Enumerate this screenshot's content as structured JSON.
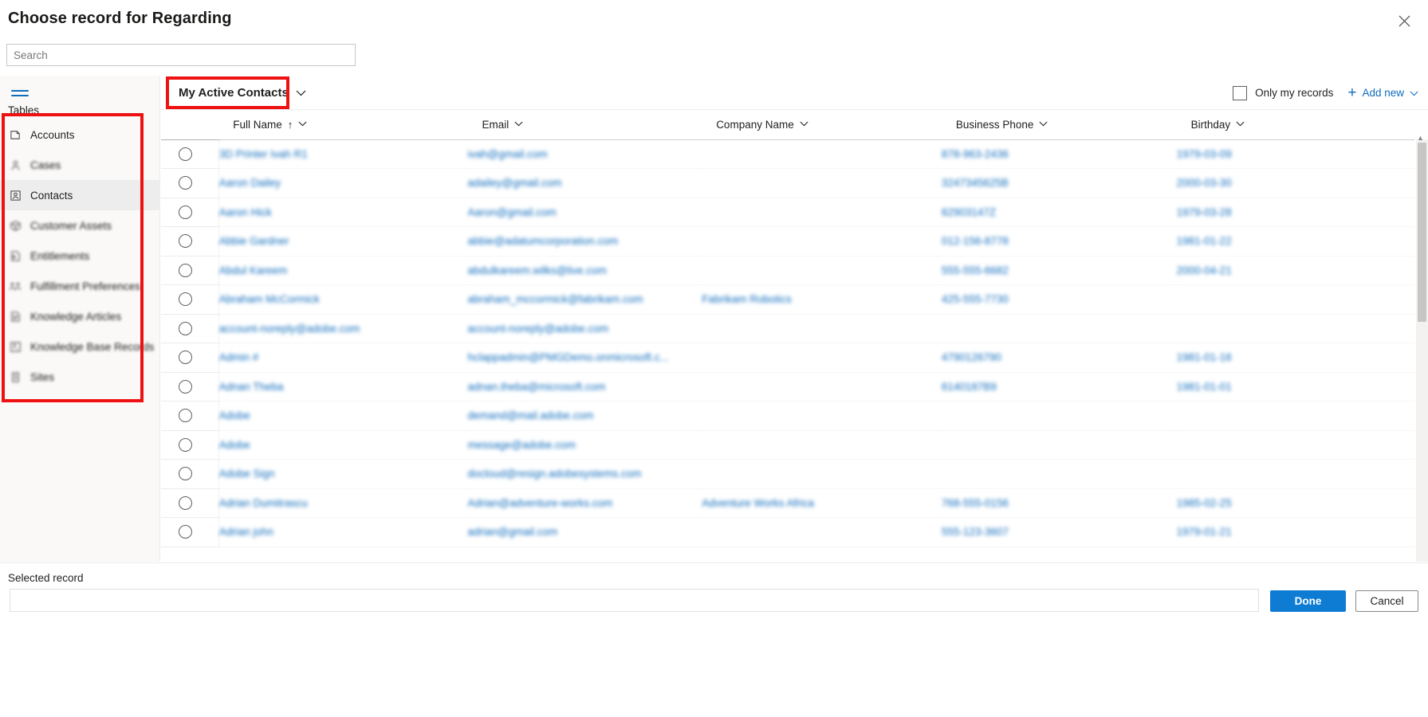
{
  "dialog": {
    "title": "Choose record for Regarding",
    "close_icon": "close-icon"
  },
  "search": {
    "placeholder": "Search",
    "value": ""
  },
  "sidebar": {
    "menu_icon": "hamburger-menu-icon",
    "heading": "Tables",
    "items": [
      {
        "label": "Accounts",
        "icon": "account-icon",
        "selected": false,
        "blurred": false
      },
      {
        "label": "Cases",
        "icon": "case-icon",
        "selected": false,
        "blurred": true
      },
      {
        "label": "Contacts",
        "icon": "contact-icon",
        "selected": true,
        "blurred": false
      },
      {
        "label": "Customer Assets",
        "icon": "box-icon",
        "selected": false,
        "blurred": true
      },
      {
        "label": "Entitlements",
        "icon": "entitlement-icon",
        "selected": false,
        "blurred": true
      },
      {
        "label": "Fulfillment Preferences",
        "icon": "people-icon",
        "selected": false,
        "blurred": true
      },
      {
        "label": "Knowledge Articles",
        "icon": "article-icon",
        "selected": false,
        "blurred": true
      },
      {
        "label": "Knowledge Base Records",
        "icon": "knowledge-base-icon",
        "selected": false,
        "blurred": true
      },
      {
        "label": "Sites",
        "icon": "site-icon",
        "selected": false,
        "blurred": true
      }
    ]
  },
  "commandbar": {
    "view_selector": "My Active Contacts",
    "view_chevron": "chevron-down-icon",
    "only_my_records": "Only my records",
    "only_my_records_checked": false,
    "add_new": "Add new",
    "add_new_chevron": "chevron-down-icon",
    "plus_icon": "plus-icon"
  },
  "grid": {
    "columns": [
      {
        "label": "Full Name",
        "sorted": true,
        "sort_direction": "asc"
      },
      {
        "label": "Email",
        "sorted": false
      },
      {
        "label": "Company Name",
        "sorted": false
      },
      {
        "label": "Business Phone",
        "sorted": false
      },
      {
        "label": "Birthday",
        "sorted": false
      }
    ],
    "sort_arrow": "↑",
    "rows": [
      {
        "full_name": "3D Printer Ivah R1",
        "email": "ivah@gmail.com",
        "company": "",
        "phone": "878-963-2436",
        "birthday": "1979-03-09"
      },
      {
        "full_name": "Aaron Dailey",
        "email": "adailey@gmail.com",
        "company": "",
        "phone": "3247345625B",
        "birthday": "2000-03-30"
      },
      {
        "full_name": "Aaron Hick",
        "email": "Aaron@gmail.com",
        "company": "",
        "phone": "62903147Z",
        "birthday": "1979-03-28"
      },
      {
        "full_name": "Abbie Gardner",
        "email": "abbie@adatumcorporation.com",
        "company": "",
        "phone": "012-156-8778",
        "birthday": "1981-01-22"
      },
      {
        "full_name": "Abdul Kareem",
        "email": "abdulkareem.wilks@live.com",
        "company": "",
        "phone": "555-555-6682",
        "birthday": "2000-04-21"
      },
      {
        "full_name": "Abraham McCormick",
        "email": "abraham_mccormick@fabrikam.com",
        "company": "Fabrikam Robotics",
        "phone": "425-555-7730",
        "birthday": ""
      },
      {
        "full_name": "account-noreply@adobe.com",
        "email": "account-noreply@adobe.com",
        "company": "",
        "phone": "",
        "birthday": ""
      },
      {
        "full_name": "Admin #",
        "email": "hclappadmin@PMGDemo.onmicrosoft.c...",
        "company": "",
        "phone": "4790126790",
        "birthday": "1981-01-16"
      },
      {
        "full_name": "Adnan Theba",
        "email": "adnan.theba@microsoft.com",
        "company": "",
        "phone": "6140187B9",
        "birthday": "1981-01-01"
      },
      {
        "full_name": "Adobe",
        "email": "demand@mail.adobe.com",
        "company": "",
        "phone": "",
        "birthday": ""
      },
      {
        "full_name": "Adobe",
        "email": "message@adobe.com",
        "company": "",
        "phone": "",
        "birthday": ""
      },
      {
        "full_name": "Adobe Sign",
        "email": "docloud@resign.adobesystems.com",
        "company": "",
        "phone": "",
        "birthday": ""
      },
      {
        "full_name": "Adrian Dumitrascu",
        "email": "Adrian@adventure-works.com",
        "company": "Adventure Works Africa",
        "phone": "768-555-0156",
        "birthday": "1985-02-25"
      },
      {
        "full_name": "Adrian john",
        "email": "adrian@gmail.com",
        "company": "",
        "phone": "555-123-3607",
        "birthday": "1979-01-21"
      }
    ]
  },
  "footer": {
    "selected_record_label": "Selected record",
    "selected_record_value": "",
    "done_label": "Done",
    "cancel_label": "Cancel"
  },
  "colors": {
    "accent": "#0f6cbd",
    "primary_button": "#0f7cd4",
    "annotation": "#ee1111"
  }
}
